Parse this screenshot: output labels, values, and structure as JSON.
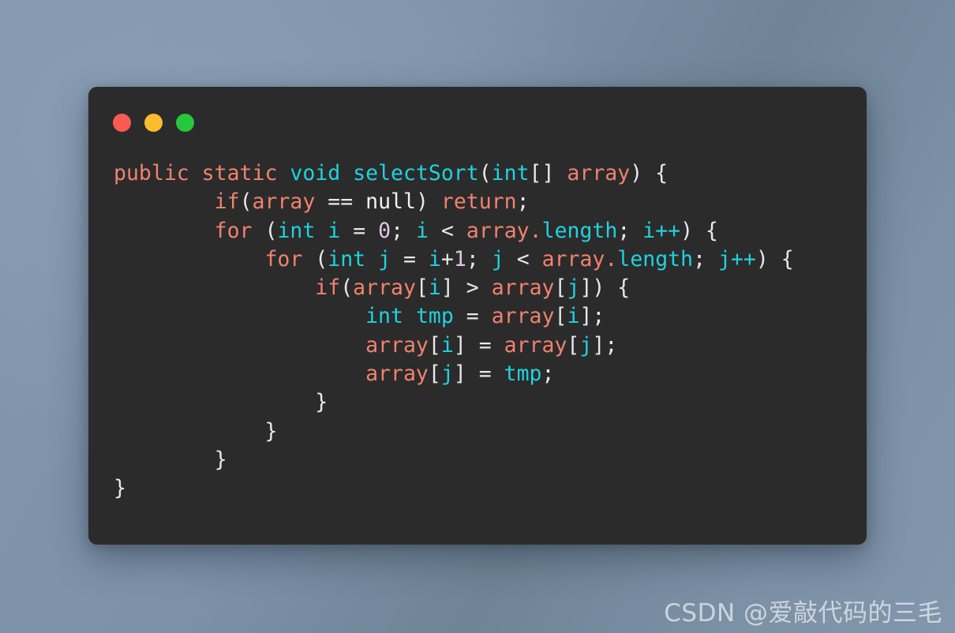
{
  "window": {
    "name": "code-snippet-window",
    "traffic_lights": [
      {
        "name": "close-button",
        "label": "Close",
        "color": "#fd5a52"
      },
      {
        "name": "minimize-button",
        "label": "Minimize",
        "color": "#fcbc2b"
      },
      {
        "name": "maximize-button",
        "label": "Maximize",
        "color": "#26c73d"
      }
    ]
  },
  "code": {
    "language": "java",
    "plain_text": "public static void selectSort(int[] array) {\n        if(array == null) return;\n        for (int i = 0; i < array.length; i++) {\n            for (int j = i+1; j < array.length; j++) {\n                if(array[i] > array[j]) {\n                    int tmp = array[i];\n                    array[i] = array[j];\n                    array[j] = tmp;\n                }\n            }\n        }\n}",
    "lines": [
      [
        {
          "t": "public static ",
          "c": "kw"
        },
        {
          "t": "void ",
          "c": "ty"
        },
        {
          "t": "selectSort",
          "c": "ty"
        },
        {
          "t": "(",
          "c": "pun"
        },
        {
          "t": "int",
          "c": "ty"
        },
        {
          "t": "[] ",
          "c": "pun"
        },
        {
          "t": "array",
          "c": "var"
        },
        {
          "t": ") {",
          "c": "pun"
        }
      ],
      [
        {
          "t": "        ",
          "c": "pun"
        },
        {
          "t": "if",
          "c": "kw"
        },
        {
          "t": "(",
          "c": "pun"
        },
        {
          "t": "array",
          "c": "var"
        },
        {
          "t": " == ",
          "c": "pun"
        },
        {
          "t": "null",
          "c": "nul"
        },
        {
          "t": ") ",
          "c": "pun"
        },
        {
          "t": "return",
          "c": "kw"
        },
        {
          "t": ";",
          "c": "pun"
        }
      ],
      [
        {
          "t": "        ",
          "c": "pun"
        },
        {
          "t": "for",
          "c": "kw"
        },
        {
          "t": " (",
          "c": "pun"
        },
        {
          "t": "int",
          "c": "ty"
        },
        {
          "t": " ",
          "c": "pun"
        },
        {
          "t": "i",
          "c": "ty"
        },
        {
          "t": " = ",
          "c": "pun"
        },
        {
          "t": "0",
          "c": "num"
        },
        {
          "t": "; ",
          "c": "pun"
        },
        {
          "t": "i",
          "c": "ty"
        },
        {
          "t": " < ",
          "c": "pun"
        },
        {
          "t": "array",
          "c": "var"
        },
        {
          "t": ".",
          "c": "var"
        },
        {
          "t": "length",
          "c": "ty"
        },
        {
          "t": "; ",
          "c": "pun"
        },
        {
          "t": "i++",
          "c": "ty"
        },
        {
          "t": ") {",
          "c": "pun"
        }
      ],
      [
        {
          "t": "            ",
          "c": "pun"
        },
        {
          "t": "for",
          "c": "kw"
        },
        {
          "t": " (",
          "c": "pun"
        },
        {
          "t": "int",
          "c": "ty"
        },
        {
          "t": " ",
          "c": "pun"
        },
        {
          "t": "j",
          "c": "ty"
        },
        {
          "t": " = ",
          "c": "pun"
        },
        {
          "t": "i",
          "c": "ty"
        },
        {
          "t": "+",
          "c": "pun"
        },
        {
          "t": "1",
          "c": "num"
        },
        {
          "t": "; ",
          "c": "pun"
        },
        {
          "t": "j",
          "c": "ty"
        },
        {
          "t": " < ",
          "c": "pun"
        },
        {
          "t": "array",
          "c": "var"
        },
        {
          "t": ".",
          "c": "var"
        },
        {
          "t": "length",
          "c": "ty"
        },
        {
          "t": "; ",
          "c": "pun"
        },
        {
          "t": "j++",
          "c": "ty"
        },
        {
          "t": ") {",
          "c": "pun"
        }
      ],
      [
        {
          "t": "                ",
          "c": "pun"
        },
        {
          "t": "if",
          "c": "kw"
        },
        {
          "t": "(",
          "c": "pun"
        },
        {
          "t": "array",
          "c": "var"
        },
        {
          "t": "[",
          "c": "pun"
        },
        {
          "t": "i",
          "c": "ty"
        },
        {
          "t": "] > ",
          "c": "pun"
        },
        {
          "t": "array",
          "c": "var"
        },
        {
          "t": "[",
          "c": "pun"
        },
        {
          "t": "j",
          "c": "ty"
        },
        {
          "t": "]) {",
          "c": "pun"
        }
      ],
      [
        {
          "t": "                    ",
          "c": "pun"
        },
        {
          "t": "int",
          "c": "ty"
        },
        {
          "t": " ",
          "c": "pun"
        },
        {
          "t": "tmp",
          "c": "ty"
        },
        {
          "t": " = ",
          "c": "pun"
        },
        {
          "t": "array",
          "c": "var"
        },
        {
          "t": "[",
          "c": "pun"
        },
        {
          "t": "i",
          "c": "ty"
        },
        {
          "t": "];",
          "c": "pun"
        }
      ],
      [
        {
          "t": "                    ",
          "c": "pun"
        },
        {
          "t": "array",
          "c": "var"
        },
        {
          "t": "[",
          "c": "pun"
        },
        {
          "t": "i",
          "c": "ty"
        },
        {
          "t": "] = ",
          "c": "pun"
        },
        {
          "t": "array",
          "c": "var"
        },
        {
          "t": "[",
          "c": "pun"
        },
        {
          "t": "j",
          "c": "ty"
        },
        {
          "t": "];",
          "c": "pun"
        }
      ],
      [
        {
          "t": "                    ",
          "c": "pun"
        },
        {
          "t": "array",
          "c": "var"
        },
        {
          "t": "[",
          "c": "pun"
        },
        {
          "t": "j",
          "c": "ty"
        },
        {
          "t": "] = ",
          "c": "pun"
        },
        {
          "t": "tmp",
          "c": "ty"
        },
        {
          "t": ";",
          "c": "pun"
        }
      ],
      [
        {
          "t": "                }",
          "c": "pun"
        }
      ],
      [
        {
          "t": "            }",
          "c": "pun"
        }
      ],
      [
        {
          "t": "        }",
          "c": "pun"
        }
      ],
      [
        {
          "t": "}",
          "c": "pun"
        }
      ]
    ]
  },
  "watermark": {
    "text": "CSDN @爱敲代码的三毛"
  },
  "colors": {
    "window_background": "#2b2b2b",
    "page_background": "#7d91a9",
    "keyword": "#f0826f",
    "type": "#1fd2de",
    "variable": "#f0826f",
    "punctuation": "#e8e8e8",
    "number": "#dcc7e3",
    "null_literal": "#f2f2f2"
  }
}
